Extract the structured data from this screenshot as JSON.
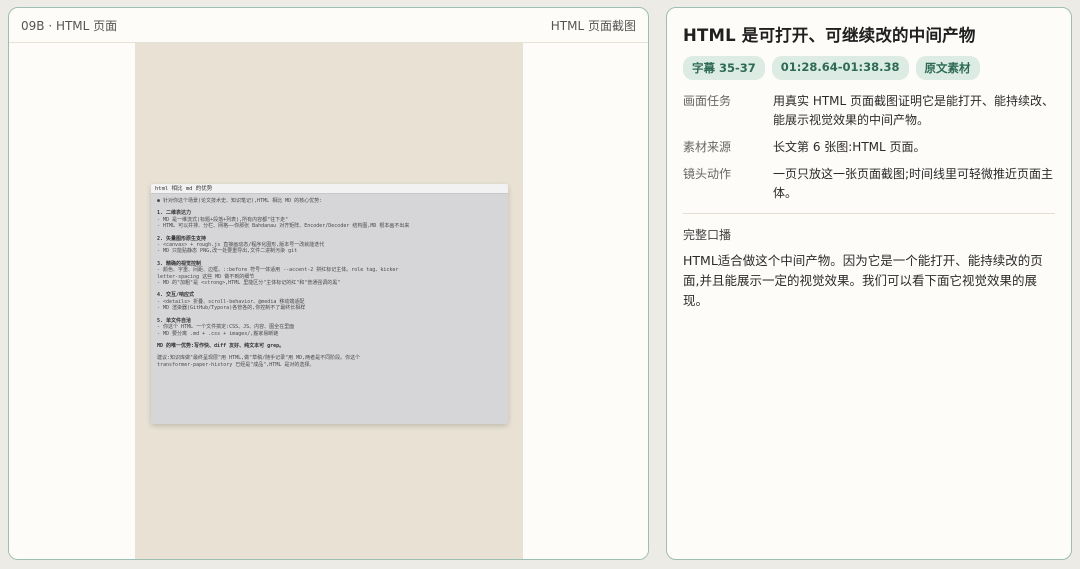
{
  "left": {
    "id_label": "09B · HTML 页面",
    "right_label": "HTML 页面截图"
  },
  "screenshot": {
    "title": "html 相比 md 的优势",
    "lines": [
      {
        "text": "● 针对你这个场景(论文技术史、知识笔记),HTML 相比 MD 的核心优势:",
        "cls": ""
      },
      {
        "text": "",
        "cls": "gap"
      },
      {
        "text": "1. 二维表达力",
        "cls": "hd"
      },
      {
        "text": "- MD 是一维流式(标题+段落+列表),所有内容都\"往下走\"",
        "cls": ""
      },
      {
        "text": "- HTML 可以并排、分栏、网格——你那张 Bahdanau 对齐矩阵、Encoder/Decoder 结构图,MD 根本画不出来",
        "cls": ""
      },
      {
        "text": "",
        "cls": "gap"
      },
      {
        "text": "2. 矢量图形原生支持",
        "cls": "hd"
      },
      {
        "text": "- <canvas> + rough.js 直接画动态/程序化图形,版本号一改就能迭代",
        "cls": ""
      },
      {
        "text": "- MD 只能贴静态 PNG,改一处要重导出,文件二进制污染 git",
        "cls": ""
      },
      {
        "text": "",
        "cls": "gap"
      },
      {
        "text": "3. 精确的视觉控制",
        "cls": "hd"
      },
      {
        "text": "- 颜色、字重、间距、边框。::before 符号一体适用 --accent-2 拼红标记主体。role tag、kicker",
        "cls": ""
      },
      {
        "text": "letter-spacing 这些 MD 做不到的细节",
        "cls": ""
      },
      {
        "text": "- MD 的\"加粗\"是 <strong>,HTML 里能区分\"主体标记的红\"和\"普通强调的黑\"",
        "cls": ""
      },
      {
        "text": "",
        "cls": "gap"
      },
      {
        "text": "4. 交互/响应式",
        "cls": "hd"
      },
      {
        "text": "- <details> 折叠、scroll-behavior、@media 移动端适配",
        "cls": ""
      },
      {
        "text": "- MD 渲染器(GitHub/Typora)各管各的,你控制不了最终长相样",
        "cls": ""
      },
      {
        "text": "",
        "cls": "gap"
      },
      {
        "text": "5. 单文件自洽",
        "cls": "hd"
      },
      {
        "text": "- 你这个 HTML 一个文件搞定:CSS、JS、内容、图全在里面",
        "cls": ""
      },
      {
        "text": "- MD 要分离 .md + .css + images/,搬家易断链",
        "cls": ""
      },
      {
        "text": "",
        "cls": "gap"
      },
      {
        "text": "MD 的唯一优势:写作快、diff 友好、纯文本可 grep。",
        "cls": "hd"
      },
      {
        "text": "",
        "cls": "gap"
      },
      {
        "text": "建议:知识库做\"最终呈现层\"用 HTML,做\"草稿/随手记录\"用 MD,两者是不同阶段。你这个",
        "cls": ""
      },
      {
        "text": "transformer-paper-history 已经是\"成品\",HTML 是对的选择。",
        "cls": ""
      }
    ]
  },
  "right": {
    "title": "HTML 是可打开、可继续改的中间产物",
    "badges": [
      "字幕 35-37",
      "01:28.64-01:38.38",
      "原文素材"
    ],
    "rows": [
      {
        "key": "画面任务",
        "value": "用真实 HTML 页面截图证明它是能打开、能持续改、能展示视觉效果的中间产物。"
      },
      {
        "key": "素材来源",
        "value": "长文第 6 张图:HTML 页面。"
      },
      {
        "key": "镜头动作",
        "value": "一页只放这一张页面截图;时间线里可轻微推近页面主体。"
      }
    ],
    "narration_label": "完整口播",
    "narration_text": "HTML适合做这个中间产物。因为它是一个能打开、能持续改的页面,并且能展示一定的视觉效果。我们可以看下面它视觉效果的展现。"
  }
}
